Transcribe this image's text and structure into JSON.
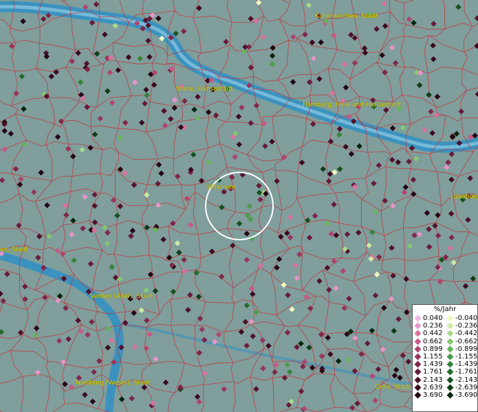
{
  "map": {
    "cities": [
      {
        "name": "Kaltenkirchen, Stadt",
        "key": "kaltenkirchen"
      },
      {
        "name": "Stade, Hansestadt",
        "key": "stade"
      },
      {
        "name": "Hamburg, Freie und Hansestadt",
        "key": "hamburg"
      },
      {
        "name": "Sittensen",
        "key": "sittensen"
      },
      {
        "name": "Lüneburg",
        "key": "lueneburg"
      },
      {
        "name": "en, Stadt",
        "key": "bremen"
      },
      {
        "name": "Verden (Aller), Stadt",
        "key": "verden"
      },
      {
        "name": "Nienburg (Weser), Stadt",
        "key": "nienburg"
      },
      {
        "name": "Celle, Stadt",
        "key": "celle"
      }
    ],
    "colors": {
      "terrain": "#7f9e9c",
      "water": "#2f8fc4",
      "boundaries": "#c8333a",
      "city_label": "#e8e200",
      "highlight_ring": "#ffffff"
    }
  },
  "legend": {
    "title": "%/Jahr",
    "rows": [
      {
        "pos": "0.040",
        "pos_color": "#f4b7e3",
        "neg": "-0.040",
        "neg_color": "#f2f7c2"
      },
      {
        "pos": "0.236",
        "pos_color": "#e694c8",
        "neg": "-0.236",
        "neg_color": "#cce9a6"
      },
      {
        "pos": "0.442",
        "pos_color": "#d8739f",
        "neg": "-0.442",
        "neg_color": "#a8d98c"
      },
      {
        "pos": "0.662",
        "pos_color": "#c65a86",
        "neg": "-0.662",
        "neg_color": "#86c773"
      },
      {
        "pos": "0.899",
        "pos_color": "#b0466f",
        "neg": "-0.899",
        "neg_color": "#67b25d"
      },
      {
        "pos": "1.155",
        "pos_color": "#97365c",
        "neg": "-1.155",
        "neg_color": "#4d9b4a"
      },
      {
        "pos": "1.439",
        "pos_color": "#7f2649",
        "neg": "-1.439",
        "neg_color": "#37833a"
      },
      {
        "pos": "1.761",
        "pos_color": "#671a3a",
        "neg": "-1.761",
        "neg_color": "#256a2c"
      },
      {
        "pos": "2.143",
        "pos_color": "#51102c",
        "neg": "-2.143",
        "neg_color": "#175321"
      },
      {
        "pos": "2.639",
        "pos_color": "#3b0a20",
        "neg": "-2.639",
        "neg_color": "#0d3d17"
      },
      {
        "pos": "3.690",
        "pos_color": "#250514",
        "neg": "-3.690",
        "neg_color": "#05250c"
      }
    ]
  }
}
